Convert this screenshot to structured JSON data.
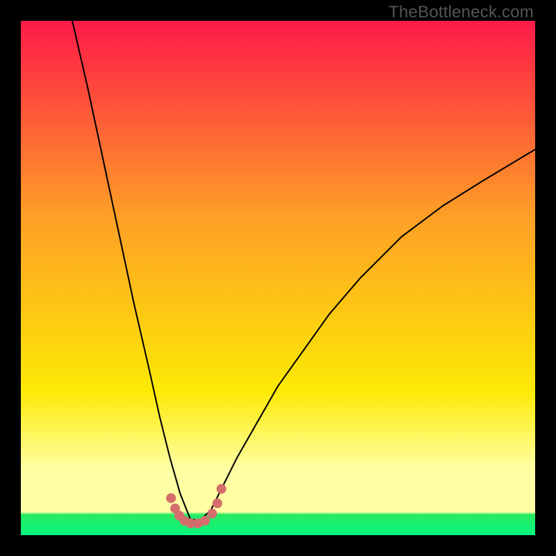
{
  "watermark": "TheBottleneck.com",
  "colors": {
    "top": "#fe1a48",
    "upper_mid": "#fe9f26",
    "mid_yellow": "#fcea04",
    "pale_yellow": "#ffffa3",
    "green_top": "#2ae961",
    "green_bottom": "#07f77e",
    "curve": "#000000",
    "dots": "#d66d6d",
    "frame": "#000000"
  },
  "chart_data": {
    "type": "line",
    "title": "",
    "xlabel": "",
    "ylabel": "",
    "xlim": [
      0,
      100
    ],
    "ylim": [
      0,
      100
    ],
    "description": "V-shaped bottleneck curve with minimum near x≈33; overlaid red dotted segment near the minimum.",
    "series": [
      {
        "name": "bottleneck-curve",
        "x": [
          10,
          13,
          16,
          19,
          22,
          25,
          27,
          29,
          31,
          33,
          35,
          37,
          39,
          42,
          46,
          50,
          55,
          60,
          66,
          74,
          82,
          90,
          100
        ],
        "values": [
          100,
          87,
          73,
          59,
          45,
          32,
          23,
          15,
          8,
          3,
          3,
          5,
          9,
          15,
          22,
          29,
          36,
          43,
          50,
          58,
          64,
          69,
          75
        ]
      },
      {
        "name": "highlight-dots",
        "x": [
          29.2,
          30.0,
          30.8,
          31.8,
          33.0,
          34.4,
          35.8,
          37.2,
          38.2,
          39.0
        ],
        "values": [
          7.2,
          5.2,
          3.8,
          2.8,
          2.3,
          2.3,
          2.8,
          4.2,
          6.2,
          9.0
        ]
      }
    ]
  }
}
